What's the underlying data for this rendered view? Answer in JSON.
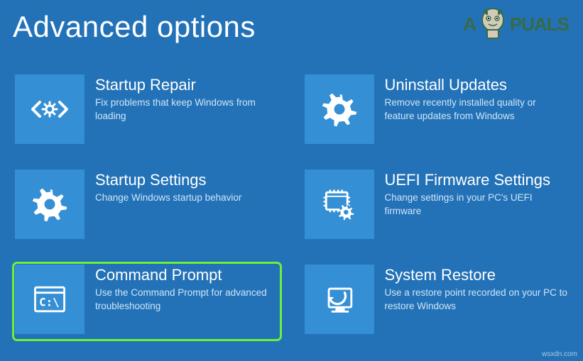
{
  "title": "Advanced options",
  "watermark": {
    "prefix": "A",
    "suffix": "PUALS"
  },
  "bottom_watermark": "wsxdn.com",
  "tiles": [
    {
      "title": "Startup Repair",
      "desc": "Fix problems that keep Windows from loading"
    },
    {
      "title": "Uninstall Updates",
      "desc": "Remove recently installed quality or feature updates from Windows"
    },
    {
      "title": "Startup Settings",
      "desc": "Change Windows startup behavior"
    },
    {
      "title": "UEFI Firmware Settings",
      "desc": "Change settings in your PC's UEFI firmware"
    },
    {
      "title": "Command Prompt",
      "desc": "Use the Command Prompt for advanced troubleshooting"
    },
    {
      "title": "System Restore",
      "desc": "Use a restore point recorded on your PC to restore Windows"
    }
  ]
}
